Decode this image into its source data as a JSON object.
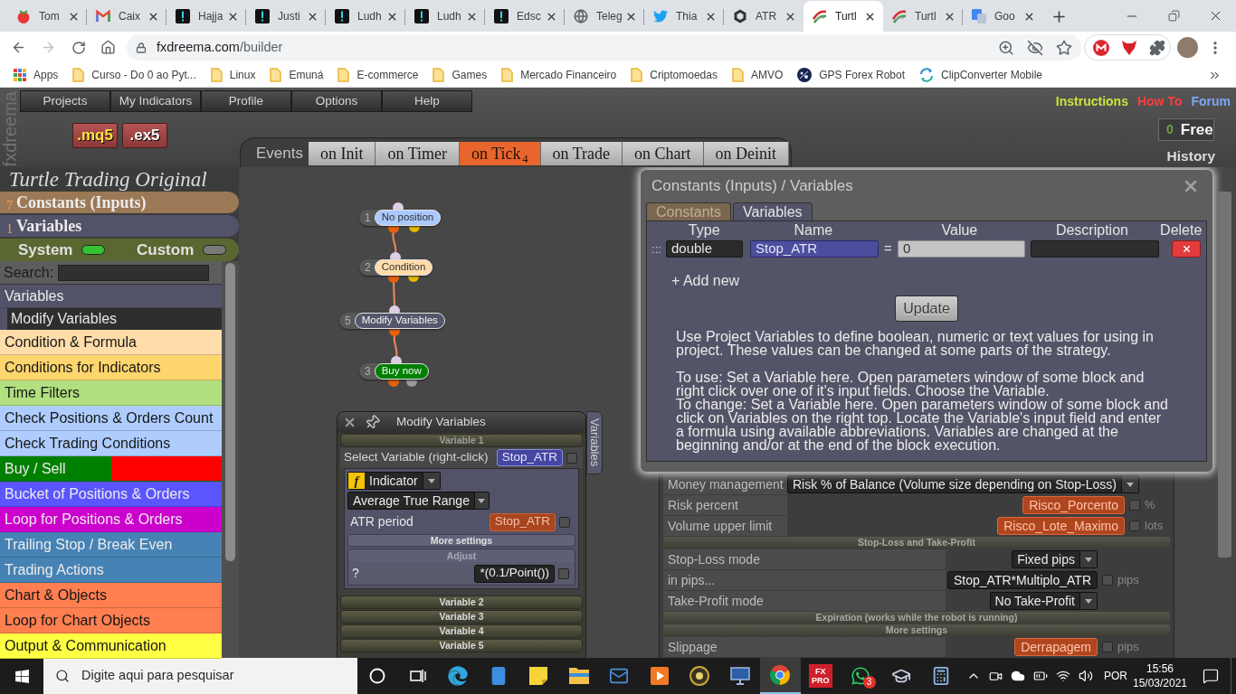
{
  "browser": {
    "tabs": [
      {
        "title": "Tom",
        "kind": "tomato",
        "selected": false
      },
      {
        "title": "Caix",
        "kind": "mail",
        "selected": false
      },
      {
        "title": "Hajja",
        "kind": "alert",
        "selected": false
      },
      {
        "title": "Justi",
        "kind": "alert",
        "selected": false
      },
      {
        "title": "Ludh",
        "kind": "alert",
        "selected": false
      },
      {
        "title": "Ludh",
        "kind": "alert",
        "selected": false
      },
      {
        "title": "Edsc",
        "kind": "alert",
        "selected": false
      },
      {
        "title": "Teleg",
        "kind": "globe",
        "selected": false
      },
      {
        "title": "Thia",
        "kind": "bird",
        "selected": false
      },
      {
        "title": "ATR",
        "kind": "hexagon",
        "selected": false
      },
      {
        "title": "Turtl",
        "kind": "swoosh",
        "selected": true
      },
      {
        "title": "Turtl",
        "kind": "swoosh",
        "selected": false
      },
      {
        "title": "Goo",
        "kind": "translate",
        "selected": false
      }
    ],
    "url": {
      "host": "fxdreema.com",
      "path": "/builder"
    },
    "bookmarks": [
      {
        "label": "Apps",
        "kind": "apps"
      },
      {
        "label": "Curso - Do 0 ao Pyt...",
        "kind": "folder"
      },
      {
        "label": "Linux",
        "kind": "folder"
      },
      {
        "label": "Emuná",
        "kind": "folder"
      },
      {
        "label": "E-commerce",
        "kind": "folder"
      },
      {
        "label": "Games",
        "kind": "folder"
      },
      {
        "label": "Mercado Financeiro",
        "kind": "folder"
      },
      {
        "label": "Criptomoedas",
        "kind": "folder"
      },
      {
        "label": "AMVO",
        "kind": "folder"
      },
      {
        "label": "GPS Forex Robot",
        "kind": "round-logo"
      },
      {
        "label": "ClipConverter Mobile",
        "kind": "sync"
      }
    ]
  },
  "app": {
    "brand": "fxdreema",
    "menu": [
      "Projects",
      "My Indicators",
      "Profile",
      "Options",
      "Help"
    ],
    "exports": [
      {
        "label": ".mq5",
        "kind": "source"
      },
      {
        "label": ".ex5",
        "kind": "compiled"
      }
    ],
    "links": [
      {
        "label": "Instructions",
        "color": "#cde33a"
      },
      {
        "label": "How To",
        "color": "#ff3c3c"
      },
      {
        "label": "Forum",
        "color": "#7ea6f5"
      }
    ],
    "plan": {
      "count": "0",
      "label": "Free"
    },
    "history": "History",
    "events": {
      "label": "Events",
      "tabs": [
        {
          "label": "on Init",
          "selected": false
        },
        {
          "label": "on Timer",
          "selected": false
        },
        {
          "label": "on Tick",
          "count": "4",
          "selected": true
        },
        {
          "label": "on Trade",
          "selected": false
        },
        {
          "label": "on Chart",
          "selected": false
        },
        {
          "label": "on Deinit",
          "selected": false
        }
      ]
    },
    "sidebar": {
      "project_title": "Turtle Trading Original",
      "sections": [
        {
          "count": "7",
          "label": "Constants (Inputs)",
          "color": "#9b7856"
        },
        {
          "count": "1",
          "label": "Variables",
          "color": "#525368"
        }
      ],
      "toggles": [
        {
          "label": "System",
          "on": true
        },
        {
          "label": "Custom",
          "on": false
        }
      ],
      "search": {
        "label": "Search:"
      },
      "categories": [
        {
          "label": "Variables",
          "color": "#525368",
          "children": [
            {
              "label": "Modify Variables"
            }
          ]
        },
        {
          "label": "Condition & Formula",
          "color": "#ffdcaa"
        },
        {
          "label": "Conditions for Indicators",
          "color": "#ffd56e"
        },
        {
          "label": "Time Filters",
          "color": "#b2e080"
        },
        {
          "label": "Check Positions & Orders Count",
          "color": "#aecdfe"
        },
        {
          "label": "Check Trading Conditions",
          "color": "#aecdfe"
        },
        {
          "label": "Buy / Sell",
          "color": "#008000",
          "second_half": {
            "color": "#ff0000"
          }
        },
        {
          "label": "Bucket of Positions & Orders",
          "color": "#5a55ff"
        },
        {
          "label": "Loop for Positions & Orders",
          "color": "#cc00cc"
        },
        {
          "label": "Trailing Stop / Break Even",
          "color": "#4682b4"
        },
        {
          "label": "Trading Actions",
          "color": "#4682b4"
        },
        {
          "label": "Chart & Objects",
          "color": "#ff7f50"
        },
        {
          "label": "Loop for Chart Objects",
          "color": "#ff7f50"
        },
        {
          "label": "Output & Communication",
          "color": "#ffff44"
        }
      ]
    },
    "canvas": {
      "blocks": [
        {
          "number": "1",
          "label": "No position",
          "color": "#a9c9ff"
        },
        {
          "number": "2",
          "label": "Condition",
          "color": "#ffdcaa"
        },
        {
          "number": "5",
          "label": "Modify Variables",
          "color": "#55586c"
        },
        {
          "number": "3",
          "label": "Buy now",
          "color": "#008000"
        }
      ]
    },
    "dialog": {
      "title": "Constants (Inputs) / Variables",
      "tabs": [
        {
          "label": "Constants",
          "selected": false
        },
        {
          "label": "Variables",
          "selected": true
        }
      ],
      "columns": [
        "Type",
        "Name",
        "Value",
        "Description",
        "Delete"
      ],
      "rows": [
        {
          "handle": ":::",
          "type": "double",
          "name": "Stop_ATR",
          "equals": "=",
          "value": "0"
        }
      ],
      "add_new": "+ Add new",
      "update": "Update",
      "help_blocks": [
        [
          "Use Project Variables to define boolean, numeric or text values for using in project. These values can be changed at some parts of the strategy."
        ],
        [
          "To use: Set a Variable here. Open parameters window of some block and right click over one of it's input fields. Choose the Variable.",
          "To change: Set a Variable here. Open parameters window of some block and click on Variables on the right top. Locate the Variable's input field and enter a formula using available abbreviations. Variables are changed at the beginning and/or at the end of the block execution."
        ]
      ]
    },
    "block_window": {
      "title": "Modify Variables",
      "side_tab": "Variables",
      "variables": [
        {
          "title": "Variable 1",
          "expanded": true,
          "select_label": "Select Variable (right-click)",
          "select_value": "Stop_ATR",
          "select_checked": false,
          "source_icon": "f",
          "source": "Indicator",
          "indicator": "Average True Range",
          "params": [
            {
              "label": "ATR period",
              "value": "Stop_ATR",
              "checked": false
            }
          ],
          "more_settings": "More settings",
          "adjust": {
            "title": "Adjust",
            "label": "?",
            "value": "*(0.1/Point())",
            "checked": false
          }
        },
        {
          "title": "Variable 2",
          "expanded": false
        },
        {
          "title": "Variable 3",
          "expanded": false
        },
        {
          "title": "Variable 4",
          "expanded": false
        },
        {
          "title": "Variable 5",
          "expanded": false
        }
      ]
    },
    "params_panel": {
      "rows": [
        {
          "kind": "select",
          "label": "Money management",
          "value": "Risk % of Balance (Volume size depending on Stop-Loss)"
        },
        {
          "kind": "variable",
          "label": "Risk percent",
          "value": "Risco_Porcento",
          "checked": false,
          "unit": "%"
        },
        {
          "kind": "variable",
          "label": "Volume upper limit",
          "value": "Risco_Lote_Maximo",
          "checked": false,
          "unit": "lots"
        },
        {
          "kind": "header",
          "label": "Stop-Loss and Take-Profit"
        },
        {
          "kind": "select",
          "label": "Stop-Loss mode",
          "value": "Fixed pips"
        },
        {
          "kind": "formula",
          "label": "in pips...",
          "value": "Stop_ATR*Multiplo_ATR",
          "checked": false,
          "unit": "pips"
        },
        {
          "kind": "select",
          "label": "Take-Profit mode",
          "value": "No Take-Profit"
        },
        {
          "kind": "header",
          "label": "Expiration (works while the robot is running)"
        },
        {
          "kind": "header",
          "label": "More settings"
        },
        {
          "kind": "variable",
          "label": "Slippage",
          "value": "Derrapagem",
          "checked": false,
          "unit": "pips"
        }
      ]
    }
  },
  "taskbar": {
    "search": {
      "placeholder": "Digite aqui para pesquisar"
    },
    "apps": [
      {
        "kind": "cortana",
        "selected": false
      },
      {
        "kind": "task-view",
        "selected": false
      },
      {
        "kind": "edge",
        "selected": false
      },
      {
        "kind": "phone",
        "selected": false
      },
      {
        "kind": "sticky-notes",
        "selected": false
      },
      {
        "kind": "explorer",
        "selected": false
      },
      {
        "kind": "mail",
        "selected": false
      },
      {
        "kind": "media",
        "selected": false
      },
      {
        "kind": "eye",
        "selected": false
      },
      {
        "kind": "remote",
        "selected": false
      },
      {
        "kind": "chrome",
        "selected": true
      },
      {
        "kind": "fxpro",
        "text": "FX PRO",
        "selected": false
      },
      {
        "kind": "whatsapp",
        "badge": "3",
        "selected": false
      },
      {
        "kind": "graduation",
        "selected": false
      },
      {
        "kind": "calculator",
        "selected": false
      }
    ],
    "tray": {
      "language": "POR",
      "time": "15:56",
      "date": "15/03/2021"
    }
  }
}
